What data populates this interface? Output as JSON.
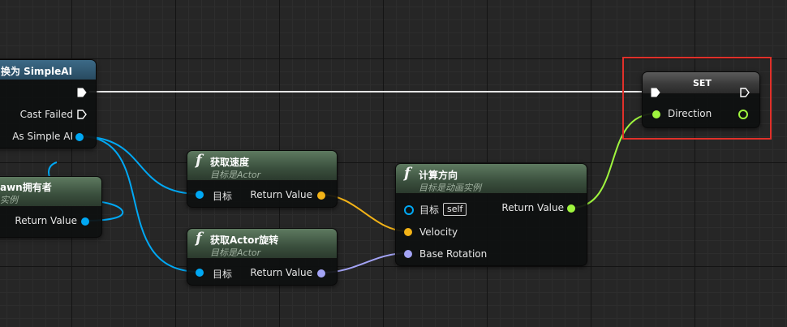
{
  "colors": {
    "exec_wire": "#e6e6e6",
    "object_pin": "#00a8f4",
    "float_pin": "#f3b317",
    "rotator_pin": "#a3a3f5",
    "vector_pin": "#9ff53e",
    "node_header": "#3a4f3d",
    "highlight": "#e0302a"
  },
  "cast_node": {
    "title": "换为 SimpleAI",
    "cast_failed": "Cast Failed",
    "as_simple_ai": "As Simple AI"
  },
  "pawn_owner_node": {
    "title": "awn拥有者",
    "subtitle": "实例",
    "return_value": "Return Value"
  },
  "get_velocity_node": {
    "icon": "function-icon",
    "title": "获取速度",
    "subtitle": "目标是Actor",
    "target": "目标",
    "return_value": "Return Value"
  },
  "get_rotation_node": {
    "icon": "function-icon",
    "title": "获取Actor旋转",
    "subtitle": "目标是Actor",
    "target": "目标",
    "return_value": "Return Value"
  },
  "calc_direction_node": {
    "icon": "function-icon",
    "title": "计算方向",
    "subtitle": "目标是动画实例",
    "target": "目标",
    "target_default": "self",
    "velocity": "Velocity",
    "base_rotation": "Base Rotation",
    "return_value": "Return Value"
  },
  "set_node": {
    "title": "SET",
    "direction": "Direction"
  }
}
